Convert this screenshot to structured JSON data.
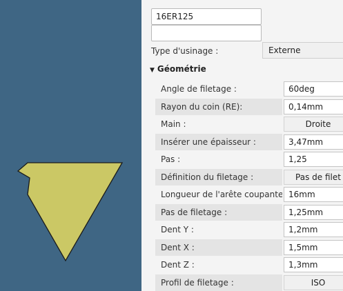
{
  "colors": {
    "viewport_bg": "#3f6684",
    "insert_fill": "#cbc865",
    "panel_bg": "#f4f4f4"
  },
  "tool": {
    "name": "16ER125",
    "second_field": ""
  },
  "machining": {
    "label": "Type d'usinage :",
    "value": "Externe"
  },
  "geometry": {
    "header": "Géométrie",
    "rows": [
      {
        "label": "Angle de filetage :",
        "value": "60deg",
        "kind": "input"
      },
      {
        "label": "Rayon du coin (RE):",
        "value": "0,14mm",
        "kind": "input"
      },
      {
        "label": "Main :",
        "value": "Droite",
        "kind": "choice"
      },
      {
        "label": "Insérer une épaisseur :",
        "value": "3,47mm",
        "kind": "input"
      },
      {
        "label": "Pas :",
        "value": "1,25",
        "kind": "input"
      },
      {
        "label": "Définition du filetage :",
        "value": "Pas de filet",
        "kind": "choice"
      },
      {
        "label": "Longueur de l'arête coupante (L):",
        "value": "16mm",
        "kind": "input"
      },
      {
        "label": "Pas de filetage :",
        "value": "1,25mm",
        "kind": "input"
      },
      {
        "label": "Dent Y :",
        "value": "1,2mm",
        "kind": "input"
      },
      {
        "label": "Dent X :",
        "value": "1,5mm",
        "kind": "input"
      },
      {
        "label": "Dent Z :",
        "value": "1,3mm",
        "kind": "input"
      },
      {
        "label": "Profil de filetage :",
        "value": "ISO",
        "kind": "choice"
      }
    ]
  }
}
